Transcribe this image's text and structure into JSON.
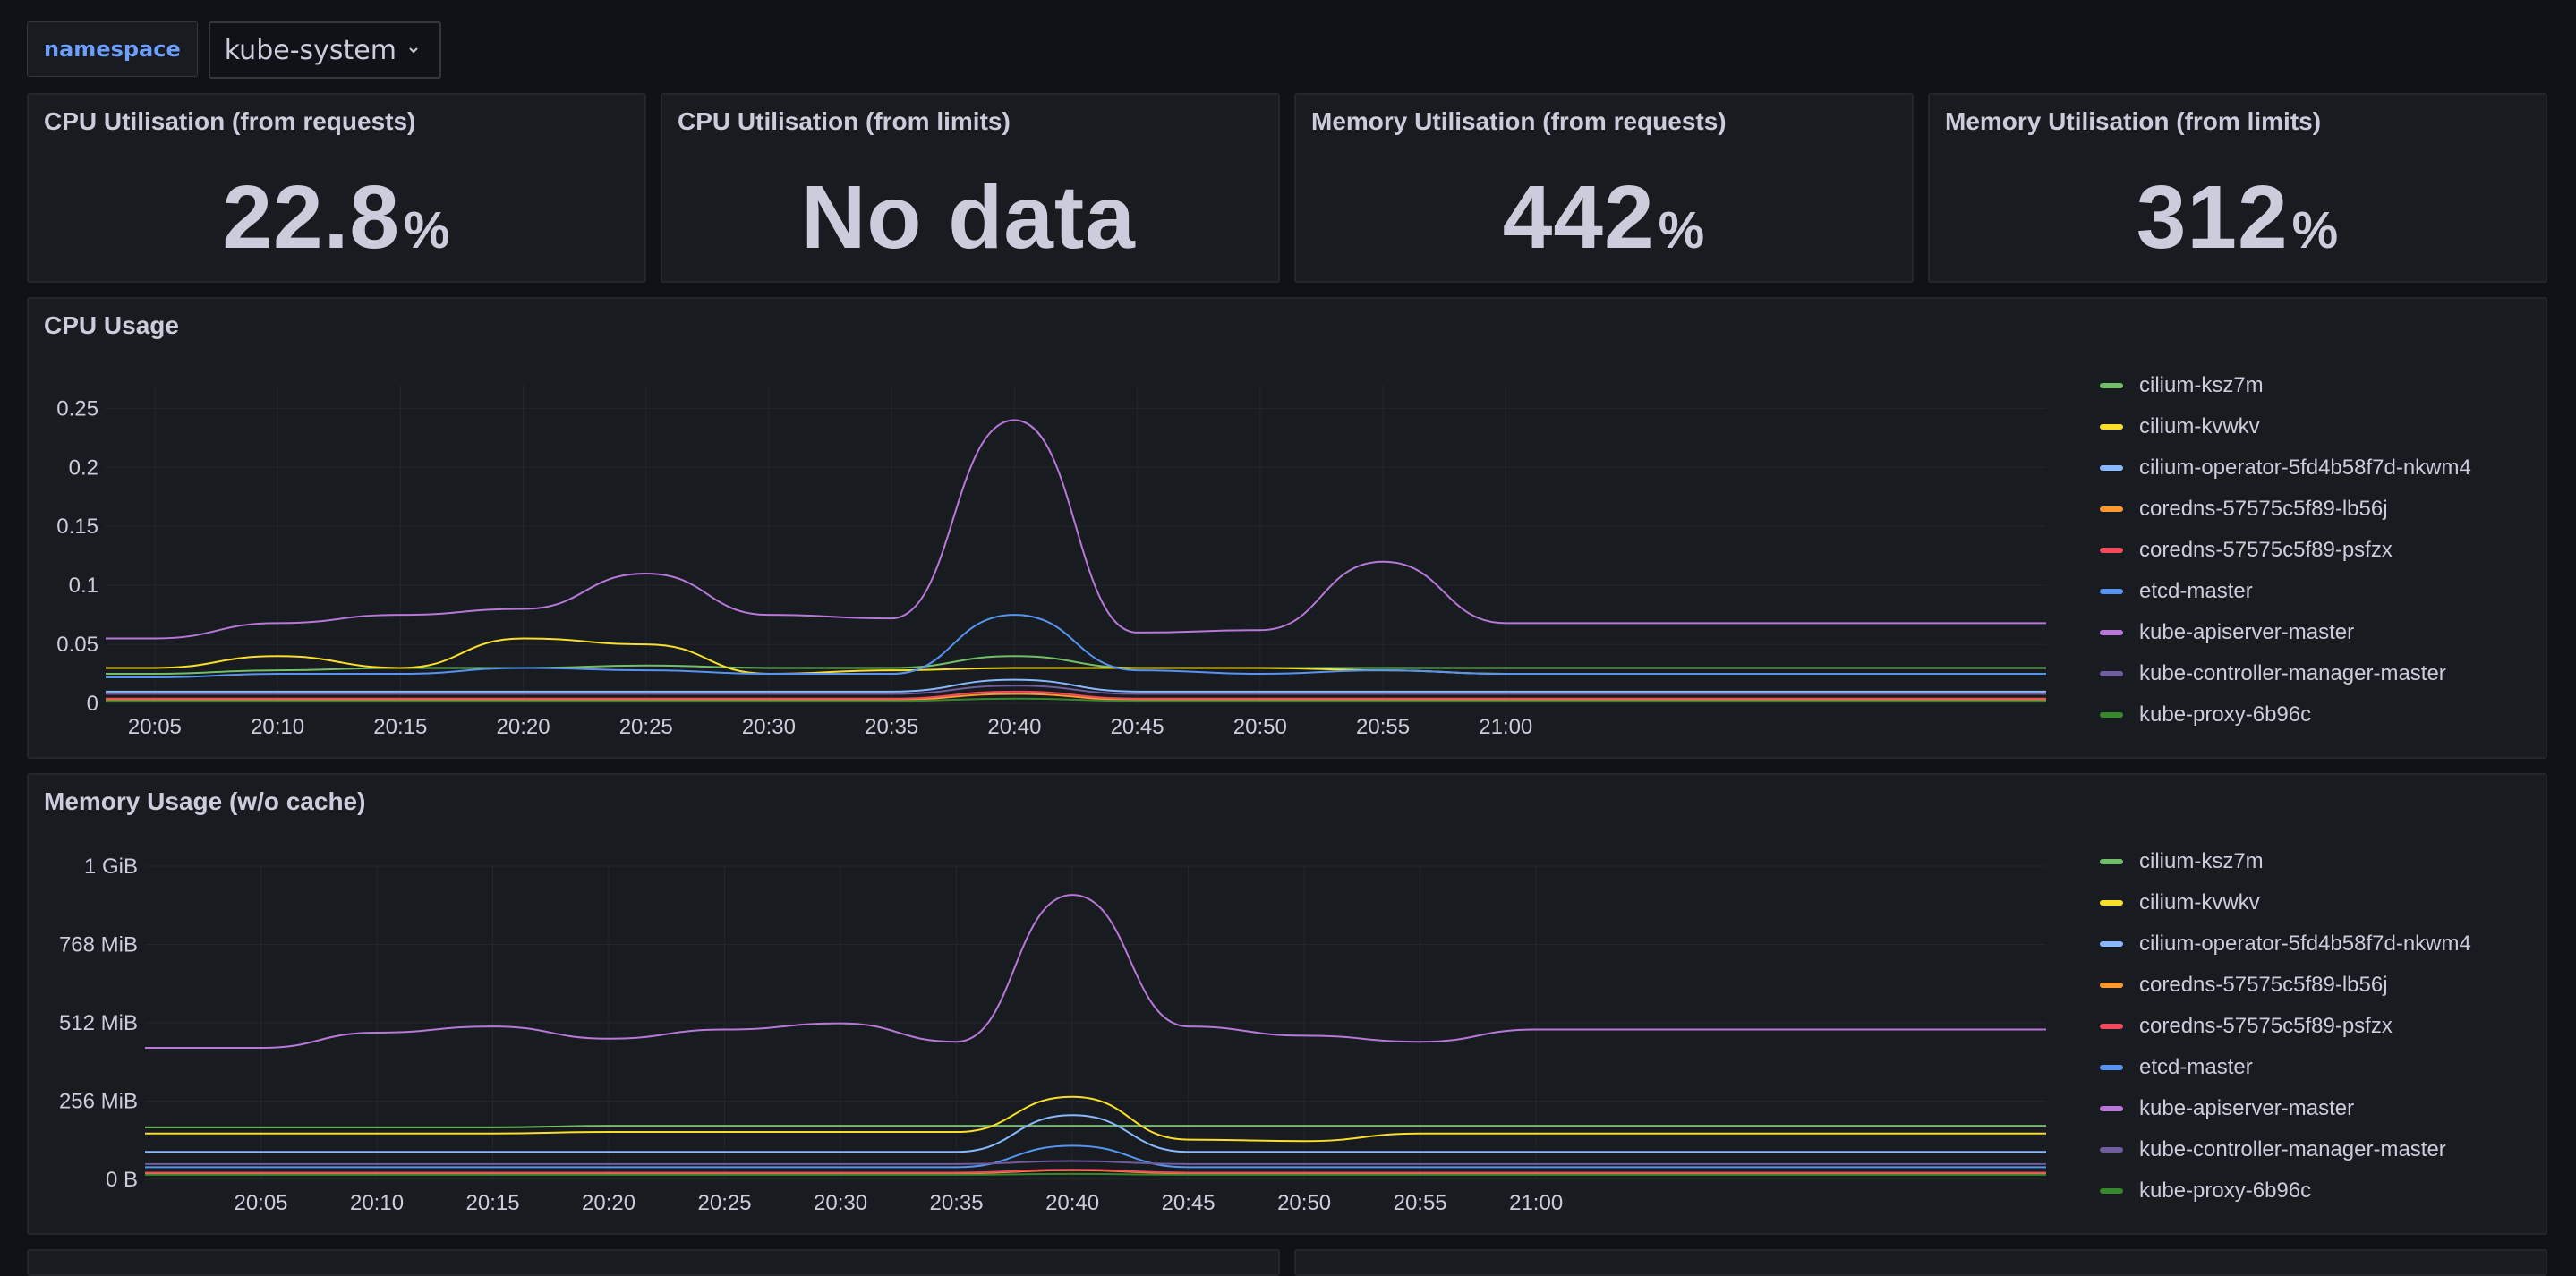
{
  "variables": {
    "label": "namespace",
    "value": "kube-system"
  },
  "stats": [
    {
      "title": "CPU Utilisation (from requests)",
      "value": "22.8",
      "unit": "%"
    },
    {
      "title": "CPU Utilisation (from limits)",
      "value": "No data",
      "unit": ""
    },
    {
      "title": "Memory Utilisation (from requests)",
      "value": "442",
      "unit": "%"
    },
    {
      "title": "Memory Utilisation (from limits)",
      "value": "312",
      "unit": "%"
    }
  ],
  "series_colors": {
    "cilium-ksz7m": "#73bf69",
    "cilium-kvwkv": "#fade2a",
    "cilium-operator-5fd4b58f7d-nkwm4": "#8ab8ff",
    "coredns-57575c5f89-lb56j": "#ff9830",
    "coredns-57575c5f89-psfzx": "#f2495c",
    "etcd-master": "#5794f2",
    "kube-apiserver-master": "#b877d9",
    "kube-controller-manager-master": "#705da0",
    "kube-proxy-6b96c": "#37872d"
  },
  "cpu_panel": {
    "title": "CPU Usage",
    "chart_data": {
      "type": "line",
      "x": [
        "20:05",
        "20:10",
        "20:15",
        "20:20",
        "20:25",
        "20:30",
        "20:35",
        "20:40",
        "20:45",
        "20:50",
        "20:55",
        "21:00"
      ],
      "xlim": [
        "20:03",
        "21:22"
      ],
      "ylim": [
        0,
        0.27
      ],
      "ytick_labels": [
        "0",
        "0.05",
        "0.1",
        "0.15",
        "0.2",
        "0.25"
      ],
      "ytick_values": [
        0,
        0.05,
        0.1,
        0.15,
        0.2,
        0.25
      ],
      "series": [
        {
          "name": "cilium-ksz7m",
          "values": [
            0.025,
            0.028,
            0.03,
            0.03,
            0.032,
            0.03,
            0.03,
            0.04,
            0.03,
            0.03,
            0.03,
            0.03
          ]
        },
        {
          "name": "cilium-kvwkv",
          "values": [
            0.03,
            0.04,
            0.03,
            0.055,
            0.05,
            0.025,
            0.028,
            0.03,
            0.03,
            0.03,
            0.028,
            0.025
          ]
        },
        {
          "name": "cilium-operator-5fd4b58f7d-nkwm4",
          "values": [
            0.01,
            0.01,
            0.01,
            0.01,
            0.01,
            0.01,
            0.01,
            0.02,
            0.01,
            0.01,
            0.01,
            0.01
          ]
        },
        {
          "name": "coredns-57575c5f89-lb56j",
          "values": [
            0.003,
            0.003,
            0.003,
            0.003,
            0.003,
            0.003,
            0.003,
            0.008,
            0.003,
            0.003,
            0.003,
            0.003
          ]
        },
        {
          "name": "coredns-57575c5f89-psfzx",
          "values": [
            0.004,
            0.004,
            0.004,
            0.004,
            0.004,
            0.004,
            0.004,
            0.01,
            0.004,
            0.004,
            0.004,
            0.004
          ]
        },
        {
          "name": "etcd-master",
          "values": [
            0.022,
            0.025,
            0.025,
            0.03,
            0.028,
            0.025,
            0.025,
            0.075,
            0.028,
            0.025,
            0.028,
            0.025
          ]
        },
        {
          "name": "kube-apiserver-master",
          "values": [
            0.055,
            0.068,
            0.075,
            0.08,
            0.11,
            0.075,
            0.072,
            0.24,
            0.06,
            0.062,
            0.12,
            0.068
          ]
        },
        {
          "name": "kube-controller-manager-master",
          "values": [
            0.008,
            0.008,
            0.008,
            0.008,
            0.008,
            0.008,
            0.008,
            0.015,
            0.008,
            0.008,
            0.008,
            0.008
          ]
        },
        {
          "name": "kube-proxy-6b96c",
          "values": [
            0.002,
            0.002,
            0.002,
            0.002,
            0.002,
            0.002,
            0.002,
            0.004,
            0.002,
            0.002,
            0.002,
            0.002
          ]
        }
      ]
    }
  },
  "mem_panel": {
    "title": "Memory Usage (w/o cache)",
    "chart_data": {
      "type": "line",
      "x": [
        "20:05",
        "20:10",
        "20:15",
        "20:20",
        "20:25",
        "20:30",
        "20:35",
        "20:40",
        "20:45",
        "20:50",
        "20:55",
        "21:00"
      ],
      "xlim": [
        "20:00",
        "21:22"
      ],
      "ylim": [
        0,
        1024
      ],
      "ytick_labels": [
        "0 B",
        "256 MiB",
        "512 MiB",
        "768 MiB",
        "1 GiB"
      ],
      "ytick_values": [
        0,
        256,
        512,
        768,
        1024
      ],
      "series": [
        {
          "name": "cilium-ksz7m",
          "values": [
            170,
            170,
            170,
            175,
            175,
            175,
            175,
            175,
            175,
            175,
            175,
            175
          ]
        },
        {
          "name": "cilium-kvwkv",
          "values": [
            150,
            150,
            150,
            155,
            155,
            155,
            155,
            270,
            130,
            125,
            150,
            150
          ]
        },
        {
          "name": "cilium-operator-5fd4b58f7d-nkwm4",
          "values": [
            90,
            90,
            90,
            90,
            90,
            90,
            90,
            210,
            90,
            90,
            90,
            90
          ]
        },
        {
          "name": "coredns-57575c5f89-lb56j",
          "values": [
            20,
            20,
            20,
            20,
            20,
            20,
            20,
            30,
            20,
            20,
            20,
            20
          ]
        },
        {
          "name": "coredns-57575c5f89-psfzx",
          "values": [
            22,
            22,
            22,
            22,
            22,
            22,
            22,
            32,
            22,
            22,
            22,
            22
          ]
        },
        {
          "name": "etcd-master",
          "values": [
            40,
            40,
            40,
            40,
            40,
            40,
            40,
            110,
            40,
            40,
            40,
            40
          ]
        },
        {
          "name": "kube-apiserver-master",
          "values": [
            430,
            480,
            500,
            460,
            490,
            510,
            450,
            930,
            500,
            470,
            450,
            490
          ]
        },
        {
          "name": "kube-controller-manager-master",
          "values": [
            50,
            50,
            50,
            50,
            50,
            50,
            50,
            60,
            50,
            50,
            50,
            50
          ]
        },
        {
          "name": "kube-proxy-6b96c",
          "values": [
            15,
            15,
            15,
            15,
            15,
            15,
            15,
            18,
            15,
            15,
            15,
            15
          ]
        }
      ]
    }
  }
}
